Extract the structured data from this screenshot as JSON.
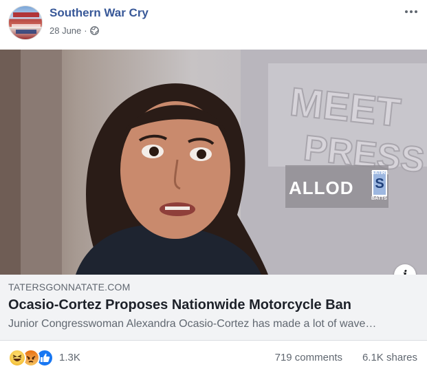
{
  "post": {
    "page_name": "Southern War Cry",
    "date": "28 June",
    "separator": "·",
    "privacy_icon": "globe-icon",
    "more_icon": "more-options-icon"
  },
  "image": {
    "watermark_text": "ALLOD",
    "badge_top": "SATIRE",
    "badge_bottom": "BATTS",
    "info_label": "i"
  },
  "link_preview": {
    "domain": "TATERSGONNATATE.COM",
    "headline": "Ocasio-Cortez Proposes Nationwide Motorcycle Ban",
    "description": "Junior Congresswoman Alexandra Ocasio-Cortez has made a lot of wave…"
  },
  "stats": {
    "reactions": [
      "haha-icon",
      "angry-icon",
      "like-icon"
    ],
    "reaction_count": "1.3K",
    "comments": "719 comments",
    "shares": "6.1K shares"
  },
  "colors": {
    "page_name": "#385898",
    "link_box_bg": "#f2f3f5",
    "like_blue": "#1877f2",
    "muted_text": "#606770"
  }
}
